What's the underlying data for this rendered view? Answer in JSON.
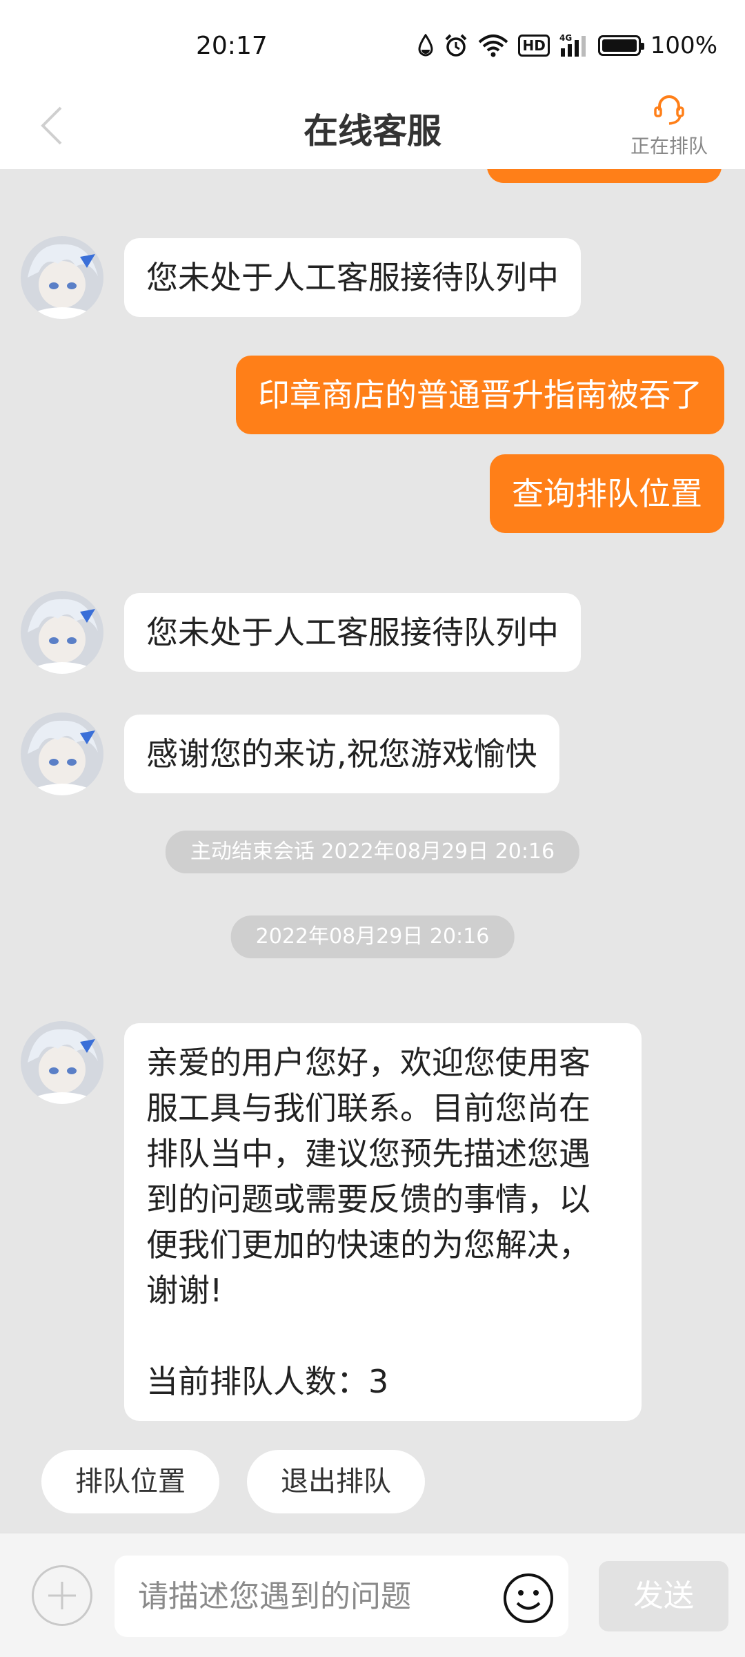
{
  "status_bar": {
    "time": "20:17",
    "icons": [
      "water-drop-icon",
      "alarm-icon",
      "wifi-icon",
      "hd-icon",
      "signal-4g-icon",
      "battery-icon"
    ],
    "hd_label": "HD",
    "network_label": "4G",
    "battery": "100%"
  },
  "header": {
    "back_icon": "chevron-left-icon",
    "title": "在线客服",
    "queue_icon": "headset-icon",
    "queue_status": "正在排队"
  },
  "colors": {
    "accent": "#ff7f18",
    "chat_bg": "#e6e6e6",
    "pill_bg": "#cfcfcf"
  },
  "messages": [
    {
      "from": "agent",
      "text": "您未处于人工客服接待队列中"
    },
    {
      "from": "user",
      "text": "印章商店的普通晋升指南被吞了"
    },
    {
      "from": "user",
      "text": "查询排队位置"
    },
    {
      "from": "agent",
      "text": "您未处于人工客服接待队列中"
    },
    {
      "from": "agent",
      "text": "感谢您的来访,祝您游戏愉快"
    },
    {
      "from": "system",
      "text": "主动结束会话 2022年08月29日 20:16"
    },
    {
      "from": "system",
      "text": "2022年08月29日 20:16"
    },
    {
      "from": "agent",
      "text": "亲爱的用户您好，欢迎您使用客\n服工具与我们联系。目前您尚在\n排队当中，建议您预先描述您遇\n到的问题或需要反馈的事情，以\n便我们更加的快速的为您解决，\n谢谢!\n\n当前排队人数：3"
    }
  ],
  "quick_actions": [
    "排队位置",
    "退出排队"
  ],
  "input_bar": {
    "plus_icon": "plus-icon",
    "placeholder": "请描述您遇到的问题",
    "value": "",
    "emoji_icon": "emoji-icon",
    "send_label": "发送"
  }
}
